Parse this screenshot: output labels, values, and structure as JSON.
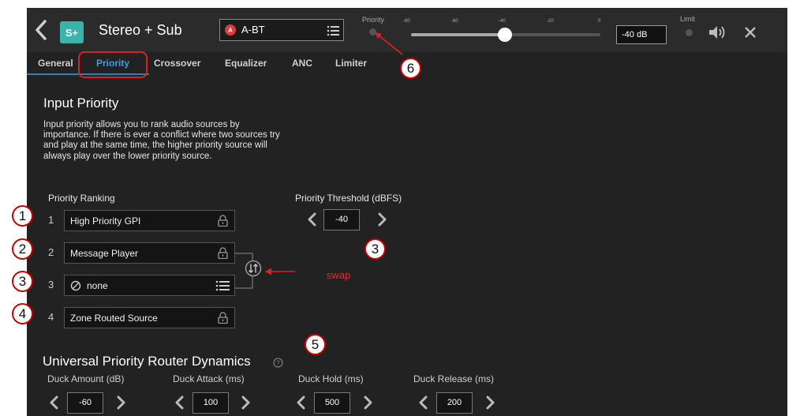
{
  "header": {
    "zone_badge": "S+",
    "zone_name": "Stereo + Sub",
    "source_badge": "A",
    "source_name": "A-BT",
    "priority_label": "Priority",
    "ticks": [
      "-80",
      "-60",
      "-40",
      "-20",
      "0"
    ],
    "volume_value": "-40 dB",
    "limit_label": "Limit"
  },
  "tabs": [
    "General",
    "Priority",
    "Crossover",
    "Equalizer",
    "ANC",
    "Limiter"
  ],
  "active_tab": "Priority",
  "input_priority": {
    "title": "Input Priority",
    "description": "Input priority allows you to rank audio sources by importance. If there is ever a conflict where two sources try and play at the same time, the higher priority source will always play over the lower priority source.",
    "ranking_label": "Priority Ranking",
    "threshold_label": "Priority Threshold (dBFS)",
    "threshold_value": "-40",
    "ranks": [
      {
        "num": "1",
        "name": "High Priority GPI",
        "locked": true
      },
      {
        "num": "2",
        "name": "Message Player",
        "locked": true
      },
      {
        "num": "3",
        "name": "none",
        "locked": false
      },
      {
        "num": "4",
        "name": "Zone Routed Source",
        "locked": true
      }
    ]
  },
  "dynamics": {
    "title": "Universal Priority Router Dynamics",
    "items": [
      {
        "label": "Duck Amount (dB)",
        "value": "-60"
      },
      {
        "label": "Duck Attack (ms)",
        "value": "100"
      },
      {
        "label": "Duck Hold (ms)",
        "value": "500"
      },
      {
        "label": "Duck Release (ms)",
        "value": "200"
      }
    ]
  },
  "annotations": {
    "callouts": [
      "1",
      "2",
      "3",
      "4",
      "3",
      "5",
      "6"
    ],
    "swap_label": "swap",
    "color": "#e02020"
  },
  "colors": {
    "background": "#222222",
    "accent": "#2f7fb3",
    "zone_badge": "#3bb3ad",
    "source_dot": "#e23a3a"
  }
}
